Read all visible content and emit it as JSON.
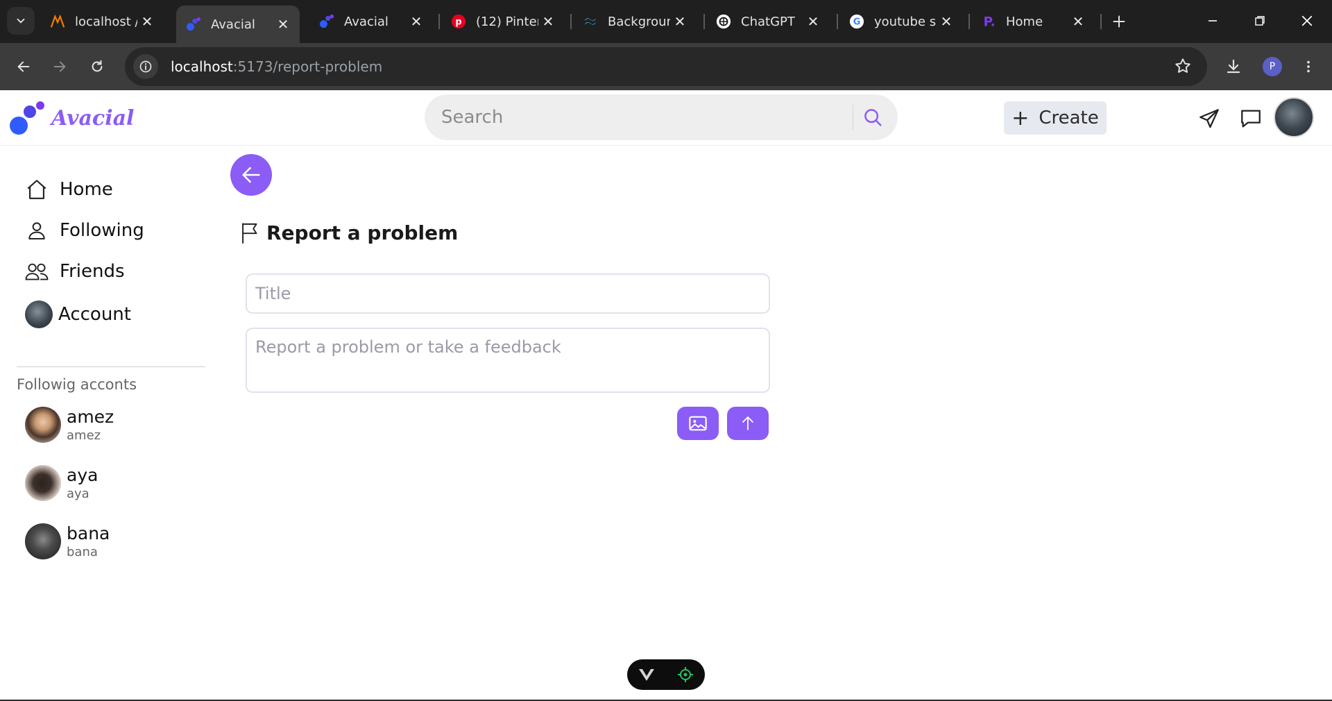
{
  "browser": {
    "tabs": [
      {
        "title": "localhost /",
        "icon": "xampp-icon"
      },
      {
        "title": "Avacial",
        "icon": "avacial-icon",
        "active": true
      },
      {
        "title": "Avacial",
        "icon": "avacial-icon"
      },
      {
        "title": "(12) Pinter",
        "icon": "pinterest-icon"
      },
      {
        "title": "Backgroun",
        "icon": "tailwind-icon"
      },
      {
        "title": "ChatGPT",
        "icon": "chatgpt-icon"
      },
      {
        "title": "youtube sl",
        "icon": "google-icon"
      },
      {
        "title": "Home",
        "icon": "p-icon"
      }
    ],
    "url_host": "localhost",
    "url_path": ":5173/report-problem",
    "profile_initial": "P"
  },
  "header": {
    "brand": "Avacial",
    "search_placeholder": "Search",
    "create_label": "Create"
  },
  "sidebar": {
    "nav": [
      {
        "label": "Home",
        "icon": "home-icon"
      },
      {
        "label": "Following",
        "icon": "user-icon"
      },
      {
        "label": "Friends",
        "icon": "users-icon"
      },
      {
        "label": "Account",
        "icon": "avatar"
      }
    ],
    "following_title": "Followig acconts",
    "following": [
      {
        "name": "amez",
        "handle": "amez"
      },
      {
        "name": "aya",
        "handle": "aya"
      },
      {
        "name": "bana",
        "handle": "bana"
      }
    ]
  },
  "main": {
    "heading": "Report a problem",
    "title_placeholder": "Title",
    "feedback_placeholder": "Report a problem or take a feedback"
  },
  "colors": {
    "accent": "#8b5cf6",
    "browser_dark": "#1f1f1f"
  }
}
